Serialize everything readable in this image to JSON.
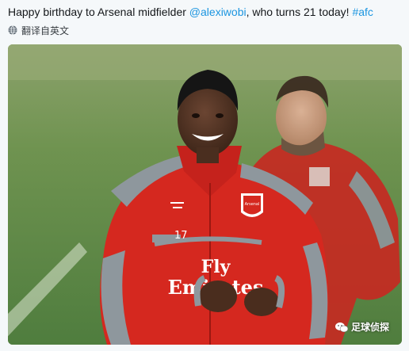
{
  "tweet": {
    "text_before": "Happy birthday to Arsenal midfielder ",
    "mention": "@alexiwobi",
    "text_middle": ", who turns 21 today! ",
    "hashtag": "#afc",
    "translate_label": "翻译自英文",
    "link_color": "#1b95e0"
  },
  "photo": {
    "jersey_number": "17",
    "sponsor_line1": "Fly",
    "sponsor_line2": "Emirates",
    "crest_text": "Arsenal"
  },
  "watermark": {
    "text": "足球侦探",
    "icon": "wechat-icon"
  }
}
